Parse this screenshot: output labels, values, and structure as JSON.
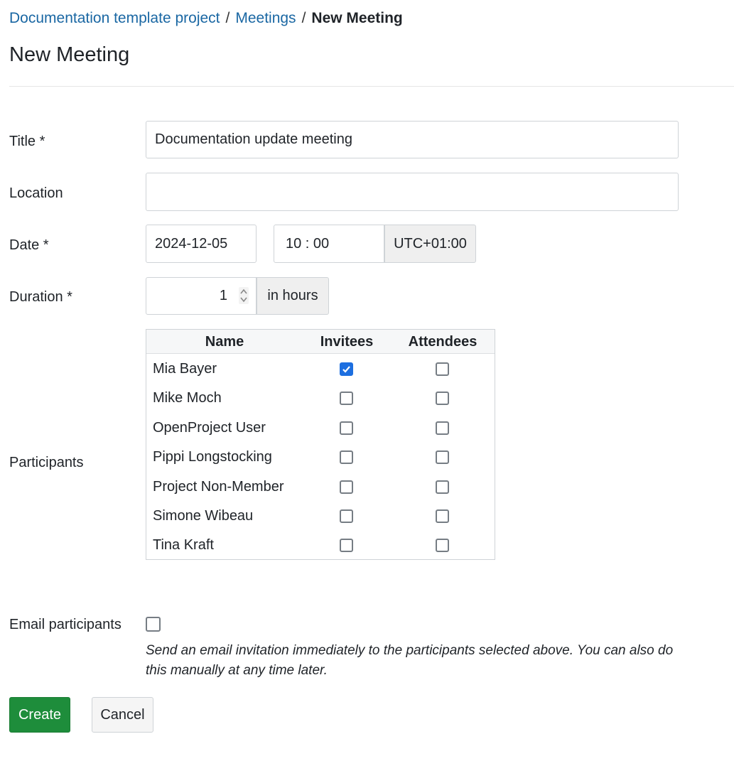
{
  "breadcrumb": {
    "project": "Documentation template project",
    "section": "Meetings",
    "current": "New Meeting",
    "separator": "/"
  },
  "page_title": "New Meeting",
  "form": {
    "title": {
      "label": "Title *",
      "value": "Documentation update meeting"
    },
    "location": {
      "label": "Location",
      "value": ""
    },
    "date": {
      "label": "Date *",
      "value": "2024-12-05",
      "time": "10 : 00",
      "timezone": "UTC+01:00"
    },
    "duration": {
      "label": "Duration *",
      "value": "1",
      "unit": "in hours"
    },
    "participants": {
      "label": "Participants",
      "headers": {
        "name": "Name",
        "invitees": "Invitees",
        "attendees": "Attendees"
      },
      "rows": [
        {
          "name": "Mia Bayer",
          "invited": true,
          "attended": false
        },
        {
          "name": "Mike Moch",
          "invited": false,
          "attended": false
        },
        {
          "name": "OpenProject User",
          "invited": false,
          "attended": false
        },
        {
          "name": "Pippi Longstocking",
          "invited": false,
          "attended": false
        },
        {
          "name": "Project Non-Member",
          "invited": false,
          "attended": false
        },
        {
          "name": "Simone Wibeau",
          "invited": false,
          "attended": false
        },
        {
          "name": "Tina Kraft",
          "invited": false,
          "attended": false
        }
      ]
    },
    "email": {
      "label": "Email participants",
      "checked": false,
      "hint": "Send an email invitation immediately to the participants selected above. You can also do this manually at any time later."
    }
  },
  "actions": {
    "create": "Create",
    "cancel": "Cancel"
  },
  "colors": {
    "link": "#1a67a3",
    "primary_button": "#1e8d3b",
    "checkbox_checked": "#1d6fe0"
  },
  "icons": {
    "spinner": "number-spinner-icon",
    "check": "checkmark-icon"
  }
}
